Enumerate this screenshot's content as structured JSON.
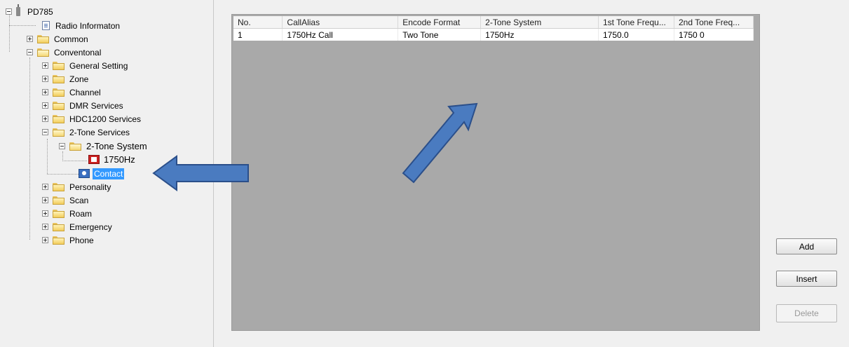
{
  "tree": {
    "root": "PD785",
    "radio_info": "Radio Informaton",
    "common": "Common",
    "conventional": "Conventonal",
    "general_setting": "General Setting",
    "zone": "Zone",
    "channel": "Channel",
    "dmr_services": "DMR Services",
    "hdc1200_services": "HDC1200 Services",
    "two_tone_services": "2-Tone Services",
    "two_tone_system": "2-Tone System",
    "item_1750": "1750Hz",
    "contact": "Contact",
    "personality": "Personality",
    "scan": "Scan",
    "roam": "Roam",
    "emergency": "Emergency",
    "phone": "Phone"
  },
  "table": {
    "headers": [
      "No.",
      "CallAlias",
      "Encode Format",
      "2-Tone System",
      "1st Tone Frequ...",
      "2nd Tone Freq..."
    ],
    "rows": [
      [
        "1",
        "1750Hz Call",
        "Two Tone",
        "1750Hz",
        "1750.0",
        "1750 0"
      ]
    ]
  },
  "buttons": {
    "add": "Add",
    "insert": "Insert",
    "delete": "Delete"
  },
  "colors": {
    "arrow_fill": "#4a7bc0",
    "arrow_stroke": "#2b4f8a",
    "selection": "#3399ff",
    "grid_background": "#a9a9a9"
  }
}
